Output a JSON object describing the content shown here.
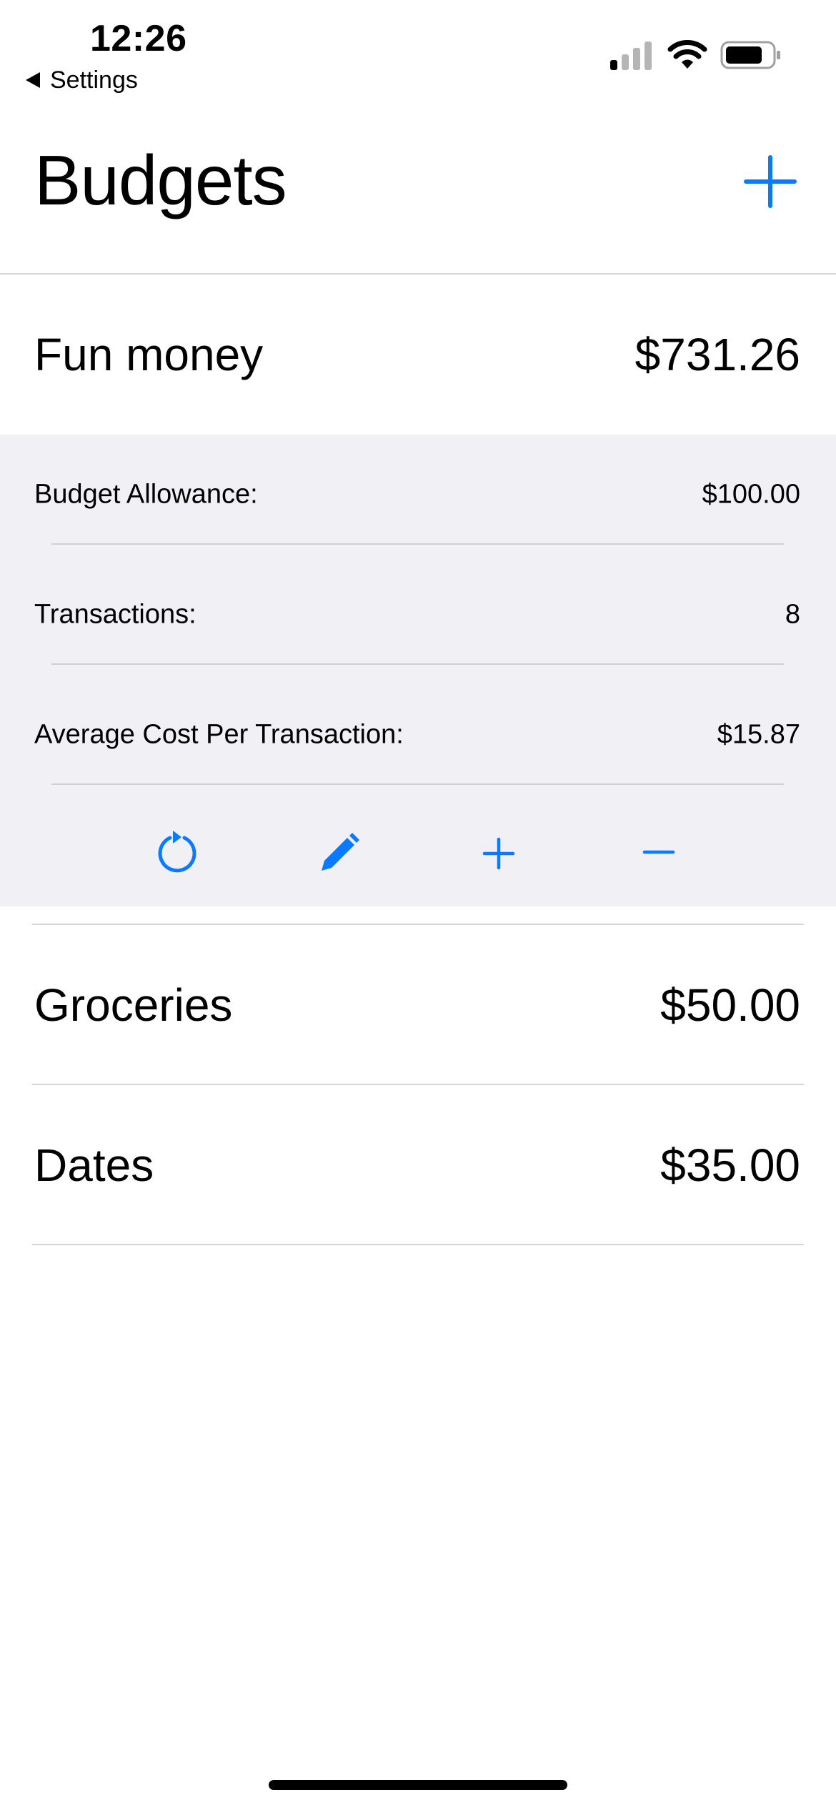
{
  "status_bar": {
    "time": "12:26",
    "back_label": "Settings"
  },
  "header": {
    "title": "Budgets"
  },
  "budgets": [
    {
      "name": "Fun money",
      "amount": "$731.26",
      "expanded": true,
      "details": {
        "allowance_label": "Budget Allowance:",
        "allowance_value": "$100.00",
        "transactions_label": "Transactions:",
        "transactions_value": "8",
        "avg_label": "Average Cost Per Transaction:",
        "avg_value": "$15.87"
      },
      "actions": [
        "reset-icon",
        "pencil-icon",
        "plus-icon",
        "minus-icon"
      ]
    },
    {
      "name": "Groceries",
      "amount": "$50.00",
      "expanded": false
    },
    {
      "name": "Dates",
      "amount": "$35.00",
      "expanded": false
    }
  ],
  "colors": {
    "accent": "#0A7AFF",
    "panel_background": "#F0F0F5",
    "separator": "#D6D6DA"
  }
}
